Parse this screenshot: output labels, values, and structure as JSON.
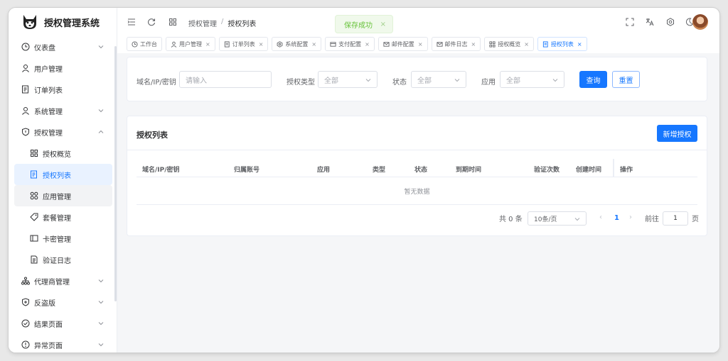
{
  "app": {
    "title": "授权管理系统"
  },
  "sidebar": {
    "items": [
      {
        "label": "仪表盘"
      },
      {
        "label": "用户管理"
      },
      {
        "label": "订单列表"
      },
      {
        "label": "系统管理"
      },
      {
        "label": "授权管理"
      },
      {
        "label": "授权概览"
      },
      {
        "label": "授权列表"
      },
      {
        "label": "应用管理"
      },
      {
        "label": "套餐管理"
      },
      {
        "label": "卡密管理"
      },
      {
        "label": "验证日志"
      },
      {
        "label": "代理商管理"
      },
      {
        "label": "反盗版"
      },
      {
        "label": "结果页面"
      },
      {
        "label": "异常页面"
      }
    ]
  },
  "header": {
    "breadcrumb": [
      "授权管理",
      "授权列表"
    ],
    "toast": "保存成功",
    "toast_close": "×"
  },
  "tabs": [
    {
      "label": "工作台"
    },
    {
      "label": "用户管理",
      "close": "×"
    },
    {
      "label": "订单列表",
      "close": "×"
    },
    {
      "label": "系统配置",
      "close": "×"
    },
    {
      "label": "支付配置",
      "close": "×"
    },
    {
      "label": "邮件配置",
      "close": "×"
    },
    {
      "label": "邮件日志",
      "close": "×"
    },
    {
      "label": "授权概览",
      "close": "×"
    },
    {
      "label": "授权列表",
      "close": "×"
    }
  ],
  "filters": {
    "domain_label": "域名/IP/密钥",
    "domain_placeholder": "请输入",
    "type_label": "授权类型",
    "type_value": "全部",
    "status_label": "状态",
    "status_value": "全部",
    "app_label": "应用",
    "app_value": "全部",
    "query": "查询",
    "reset": "重置"
  },
  "list": {
    "title": "授权列表",
    "add": "新增授权",
    "columns": [
      "域名/IP/密钥",
      "归属账号",
      "应用",
      "类型",
      "状态",
      "到期时间",
      "验证次数",
      "创建时间",
      "操作"
    ],
    "empty": "暂无数据"
  },
  "pagination": {
    "total": "共 0 条",
    "page_size": "10条/页",
    "prev": "‹",
    "current": "1",
    "next": "›",
    "goto": "前往",
    "goto_value": "1",
    "page_unit": "页"
  },
  "colors": {
    "primary": "#1677ff",
    "success": "#67c23a"
  }
}
